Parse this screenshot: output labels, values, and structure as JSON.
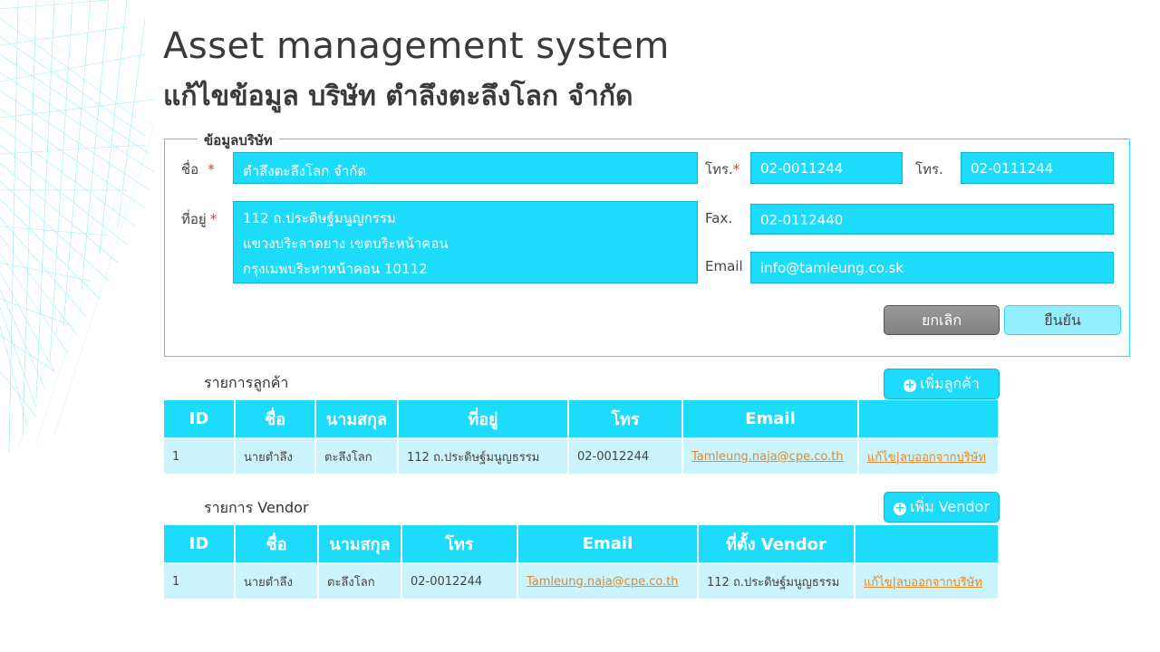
{
  "app": {
    "title": "Asset management system",
    "subtitle": "แก้ไขข้อมูล บริษัท ตำลึงตะลึงโลก จำกัด"
  },
  "company": {
    "legend": "ข้อมูลบริษัท",
    "name_label": "ชื่อ",
    "name_value": "ตำลึงตะลึงโลก จำกัด",
    "address_label": "ที่อยู่",
    "address_value": "112 ถ.ประดิษฐ์มนูญกรรม\nแขวงบริะลาดยาง เขตบริะหน้าคอน\nกรุงเมพบริะหาหน้าคอน 10112",
    "required_mark": "*",
    "phone1_label": "โทร.",
    "phone1_value": "02-0011244",
    "phone2_label": "โทร.",
    "phone2_value": "02-0111244",
    "fax_label": "Fax.",
    "fax_value": "02-0112440",
    "email_label": "Email",
    "email_value": "info@tamleung.co.sk",
    "cancel_label": "ยกเลิก",
    "confirm_label": "ยืนยัน"
  },
  "customers": {
    "title": "รายการลูกค้า",
    "add_label": "เพิ่มลูกค้า",
    "headers": [
      "ID",
      "ชื่อ",
      "นามสกุล",
      "ที่อยู่",
      "โทร",
      "Email",
      ""
    ],
    "rows": [
      {
        "id": "1",
        "first": "นายตำลึง",
        "last": "ตะลึงโลก",
        "address": "112 ถ.ประดิษฐ์มนูญธรรม",
        "phone": "02-0012244",
        "email": "Tamleung.naja@cpe.co.th",
        "action": "แก้ไข|ลบออกจากบริษัท"
      }
    ]
  },
  "vendors": {
    "title": "รายการ Vendor",
    "add_label": "เพิ่ม Vendor",
    "headers": [
      "ID",
      "ชื่อ",
      "นามสกุล",
      "โทร",
      "Email",
      "ที่ตั้ง Vendor",
      ""
    ],
    "rows": [
      {
        "id": "1",
        "first": "นายตำลึง",
        "last": "ตะลึงโลก",
        "phone": "02-0012244",
        "email": "Tamleung.naja@cpe.co.th",
        "location": "112 ถ.ประดิษฐ์มนูญธรรม",
        "action": "แก้ไข|ลบออกจากบริษัท"
      }
    ]
  },
  "colors": {
    "accent": "#1ddcfb",
    "row_bg": "#cbf3fb",
    "link": "#e3892a"
  }
}
